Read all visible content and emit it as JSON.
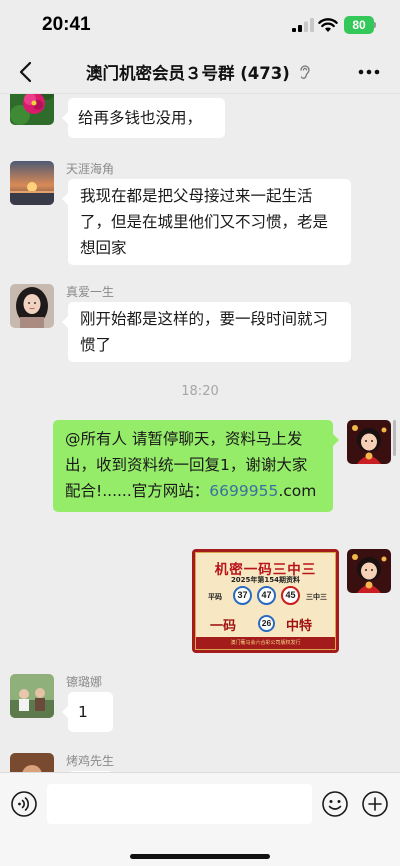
{
  "status_bar": {
    "time": "20:41",
    "battery": "80"
  },
  "header": {
    "title": "澳门机密会员３号群 (473)",
    "back_icon": "chevron-left-icon",
    "more_icon": "more-dots-icon",
    "mute_icon": "ear-icon"
  },
  "messages": [
    {
      "side": "in",
      "sender": "",
      "text": "给再多钱也没用，"
    },
    {
      "side": "in",
      "sender": "天涯海角",
      "text": "我现在都是把父母接过来一起生活了，但是在城里他们又不习惯，老是想回家"
    },
    {
      "side": "in",
      "sender": "真爱一生",
      "text": "刚开始都是这样的，要一段时间就习惯了"
    },
    {
      "type": "time",
      "text": "18:20"
    },
    {
      "side": "out",
      "text_prefix": "@所有人 请暂停聊天，资料马上发出，收到资料统一回复1，谢谢大家配合!......官方网站：",
      "link": "6699955",
      "text_suffix": ".com"
    },
    {
      "side": "out",
      "type": "image",
      "image": {
        "title": "机密一码三中三",
        "subtitle": "2025年第154期资料",
        "label_left": "平码",
        "label_right": "三中三",
        "numbers": [
          "37",
          "47",
          "45"
        ],
        "big_left": "一码",
        "special": "26",
        "big_right": "中特",
        "footer": "澳门葡马会六合彩公司版权发行"
      }
    },
    {
      "side": "in",
      "sender": "镲璐娜",
      "text": "1"
    },
    {
      "side": "in",
      "sender": "烤鸡先生",
      "text": ""
    }
  ],
  "input_bar": {
    "placeholder": "",
    "voice_icon": "voice-icon",
    "emoji_icon": "emoji-icon",
    "plus_icon": "plus-icon"
  },
  "colors": {
    "background": "#ededed",
    "bubble_out": "#95ec69",
    "bubble_in": "#ffffff",
    "link": "#3b6fa1",
    "battery": "#34c759"
  }
}
